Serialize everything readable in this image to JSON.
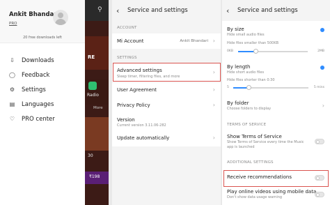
{
  "drawer": {
    "user_name": "Ankit Bhandari",
    "plan": "PRO",
    "free_downloads": "20 free downloads left",
    "items": [
      {
        "label": "Downloads"
      },
      {
        "label": "Feedback"
      },
      {
        "label": "Settings"
      },
      {
        "label": "Languages"
      },
      {
        "label": "PRO center"
      }
    ],
    "bg_labels": {
      "radio": "Radio",
      "more": "More",
      "price": "₹198",
      "num": "30",
      "ex": "RE"
    }
  },
  "screen2": {
    "title": "Service and settings",
    "section_account": "ACCOUNT",
    "mi_account": {
      "label": "Mi Account",
      "value": "Ankit Bhandari"
    },
    "section_settings": "SETTINGS",
    "advanced": {
      "label": "Advanced settings",
      "sub": "Sleep timer, filtering files, and more"
    },
    "user_agreement": "User Agreement",
    "privacy_policy": "Privacy Policy",
    "version": {
      "label": "Version",
      "sub": "Current version 3.11.06-282"
    },
    "update": "Update automatically"
  },
  "screen3": {
    "title": "Service and settings",
    "by_size": {
      "label": "By size",
      "sub": "Hide small audio files",
      "sub2": "Hide files smaller than 500KB",
      "min": "0KB",
      "max": "2MB",
      "level": 0.25
    },
    "by_length": {
      "label": "By length",
      "sub": "Hide short audio files",
      "sub2": "Hide files shorter than 0:30",
      "min": "5",
      "max": "5 mins",
      "level": 0.2
    },
    "by_folder": {
      "label": "By folder",
      "sub": "Choose folders to display"
    },
    "section_terms": "TERMS OF SERVICE",
    "show_terms": {
      "label": "Show Terms of Service",
      "sub": "Show Terms of Service every time the Music app is launched"
    },
    "section_additional": "ADDITIONAL SETTINGS",
    "receive_recommendations": "Receive recommendations",
    "play_online": {
      "label": "Play online videos using mobile data",
      "sub": "Don't show data usage warning"
    }
  },
  "colors": {
    "accent": "#2f8cff",
    "highlight": "#d9534f"
  }
}
